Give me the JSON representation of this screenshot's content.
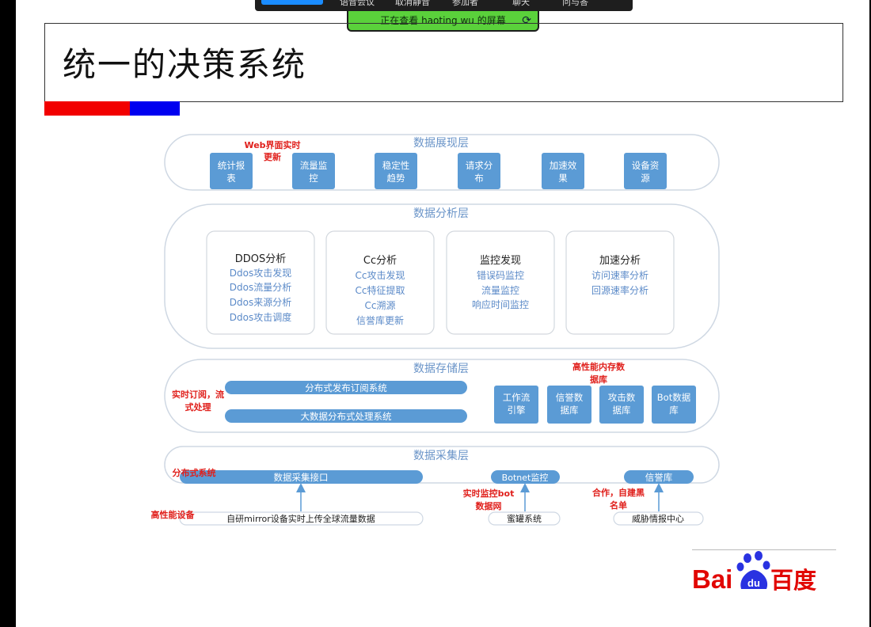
{
  "toolbar": {
    "items": [
      "语音会议",
      "取消静音",
      "参加者",
      "聊天",
      "问与答"
    ],
    "share_banner": "正在查看 haoting wu 的屏幕"
  },
  "slide": {
    "title": "统一的决策系统",
    "accent_colors": {
      "red": "#f20000",
      "blue": "#0000f0"
    }
  },
  "diagram": {
    "layers": {
      "presentation": {
        "title": "数据展现层",
        "boxes": [
          [
            "统计报",
            "表"
          ],
          [
            "流量监",
            "控"
          ],
          [
            "稳定性",
            "趋势"
          ],
          [
            "请求分",
            "布"
          ],
          [
            "加速效",
            "果"
          ],
          [
            "设备资",
            "源"
          ]
        ],
        "note": [
          "Web界面实时",
          "更新"
        ]
      },
      "analysis": {
        "title": "数据分析层",
        "cards": [
          {
            "title": "DDOS分析",
            "items": [
              "Ddos攻击发现",
              "Ddos流量分析",
              "Ddos来源分析",
              "Ddos攻击调度"
            ]
          },
          {
            "title": "Cc分析",
            "items": [
              "Cc攻击发现",
              "Cc特征提取",
              "Cc溯源",
              "信誉库更新"
            ]
          },
          {
            "title": "监控发现",
            "items": [
              "错误码监控",
              "流量监控",
              "响应时间监控"
            ]
          },
          {
            "title": "加速分析",
            "items": [
              "访问速率分析",
              "回源速率分析"
            ]
          }
        ]
      },
      "storage": {
        "title": "数据存储层",
        "bars": [
          "分布式发布订阅系统",
          "大数据分布式处理系统"
        ],
        "boxes": [
          [
            "工作流",
            "引擎"
          ],
          [
            "信誉数",
            "据库"
          ],
          [
            "攻击数",
            "据库"
          ],
          [
            "Bot数据",
            "库"
          ]
        ],
        "note_left": [
          "实时订阅，流",
          "式处理"
        ],
        "note_right": [
          "高性能内存数",
          "据库"
        ]
      },
      "collection": {
        "title": "数据采集层",
        "bars": [
          "数据采集接口",
          "Botnet监控",
          "信誉库"
        ],
        "note": "分布式系统"
      }
    },
    "sources": {
      "boxes": [
        "自研mirror设备实时上传全球流量数据",
        "蜜罐系统",
        "威胁情报中心"
      ],
      "label_left": "高性能设备",
      "label_mid": [
        "实时监控bot",
        "数据网"
      ],
      "label_right": [
        "合作，自建黑",
        "名单"
      ]
    },
    "colors": {
      "box": "#5b9bd5",
      "layer_title": "#6a94c8",
      "item_text": "#5b8ac8",
      "note_red": "#e0201c",
      "layer_border": "#cfd8e3"
    }
  },
  "logo": {
    "text_left": "Bai",
    "paw_text": "du",
    "text_right": "百度",
    "red": "#e10602",
    "blue": "#2932e1"
  }
}
